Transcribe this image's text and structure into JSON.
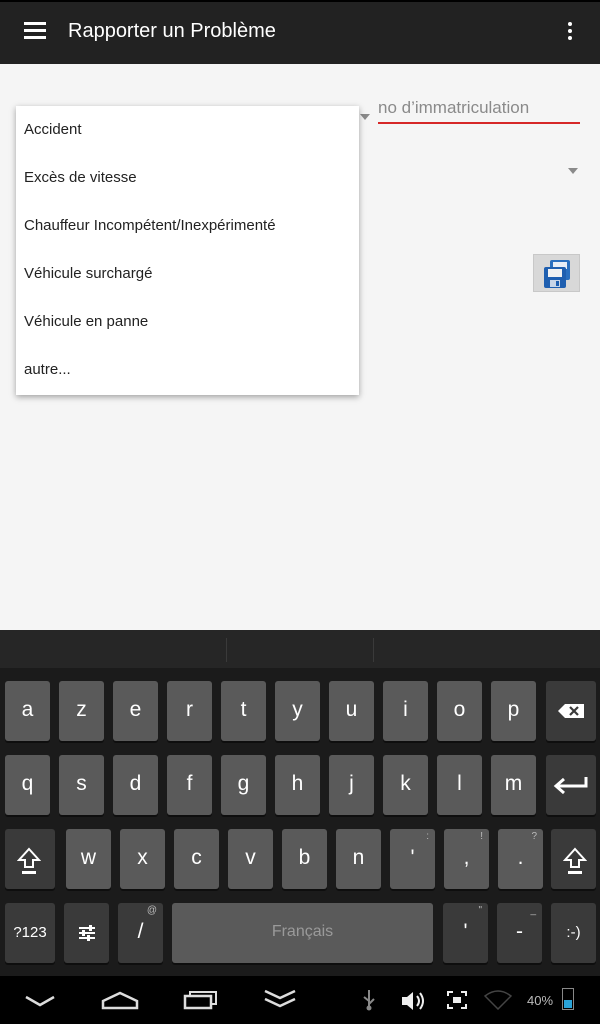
{
  "app_bar": {
    "title": "Rapporter un Problème",
    "menu_icon": "hamburger-menu-icon",
    "overflow_icon": "overflow-menu-icon"
  },
  "form": {
    "plate_placeholder": "no d’immatriculation",
    "save_icon": "floppy-disk-icon"
  },
  "dropdown": {
    "options": [
      "Accident",
      "Excès de vitesse",
      "Chauffeur Incompétent/Inexpérimenté",
      "Véhicule surchargé",
      "Véhicule en panne",
      "autre..."
    ]
  },
  "keyboard": {
    "row1": [
      "a",
      "z",
      "e",
      "r",
      "t",
      "y",
      "u",
      "i",
      "o",
      "p"
    ],
    "row2": [
      "q",
      "s",
      "d",
      "f",
      "g",
      "h",
      "j",
      "k",
      "l",
      "m"
    ],
    "row3": [
      "w",
      "x",
      "c",
      "v",
      "b",
      "n",
      "'",
      ",",
      "."
    ],
    "row3_hints": [
      "",
      "",
      "",
      "",
      "",
      "",
      ":",
      "!",
      "?"
    ],
    "symbols_label": "?123",
    "slash_label": "/",
    "slash_hint": "@",
    "space_label": "Français",
    "apostrophe_label": "'",
    "apostrophe_hint": "\"",
    "dash_label": "-",
    "dash_hint": "_",
    "smiley_label": ":-)"
  },
  "status": {
    "battery_percent": "40%",
    "battery_level": 0.4,
    "accent_color": "#d62828"
  }
}
